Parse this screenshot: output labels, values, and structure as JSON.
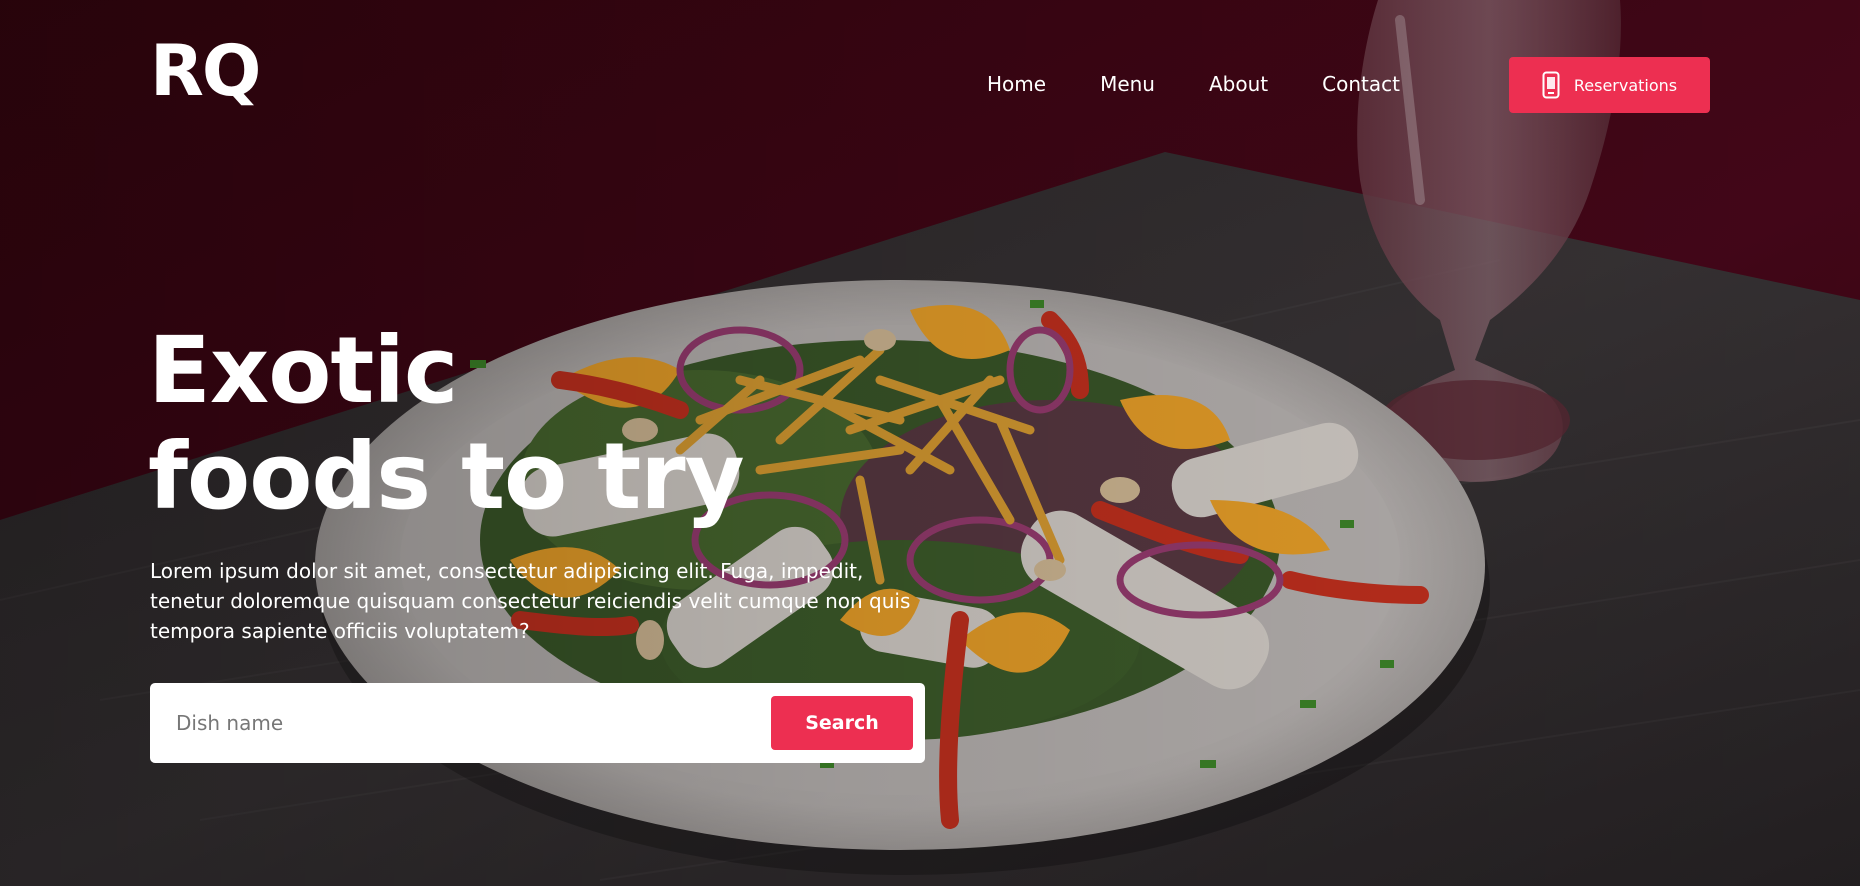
{
  "brand": {
    "logo": "RQ"
  },
  "nav": {
    "items": [
      "Home",
      "Menu",
      "About",
      "Contact"
    ]
  },
  "header": {
    "reservations_label": "Reservations",
    "reservations_icon": "phone-icon"
  },
  "hero": {
    "headline_line1": "Exotic",
    "headline_line2": "foods to try",
    "description": "Lorem ipsum dolor sit amet, consectetur adipisicing elit. Fuga, impedit, tenetur doloremque quisquam consectetur reiciendis velit cumque non quis tempora sapiente officiis voluptatem?"
  },
  "search": {
    "placeholder": "Dish name",
    "value": "",
    "button_label": "Search"
  },
  "colors": {
    "accent": "#ed2f51",
    "wall": "#3d0710",
    "table": "#2a2527",
    "white": "#ffffff"
  }
}
